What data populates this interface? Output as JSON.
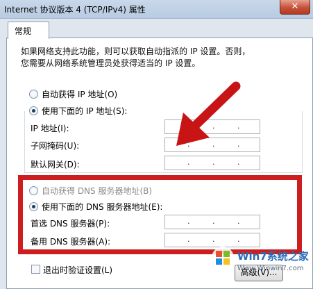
{
  "window": {
    "title": "Internet 协议版本 4 (TCP/IPv4) 属性",
    "close_label": "✕"
  },
  "tab": {
    "label": "常规"
  },
  "description": {
    "line1": "如果网络支持此功能，则可以获取自动指派的 IP 设置。否则，",
    "line2": "您需要从网络系统管理员处获得适当的 IP 设置。"
  },
  "ip": {
    "auto_label": "自动获得 IP 地址(O)",
    "manual_label": "使用下面的 IP 地址(S):",
    "address_label": "IP 地址(I):",
    "mask_label": "子网掩码(U):",
    "gateway_label": "默认网关(D):"
  },
  "dns": {
    "auto_label": "自动获得 DNS 服务器地址(B)",
    "manual_label": "使用下面的 DNS 服务器地址(E):",
    "preferred_label": "首选 DNS 服务器(P):",
    "alternate_label": "备用 DNS 服务器(A):"
  },
  "validate_label": "退出时验证设置(L)",
  "advanced_button": "高级(V)...",
  "watermark": {
    "brand": "Win7系统之家",
    "url": "Www.Winwin7.com"
  },
  "colors": {
    "highlight_box": "#cc1e1e",
    "arrow": "#c81414"
  }
}
